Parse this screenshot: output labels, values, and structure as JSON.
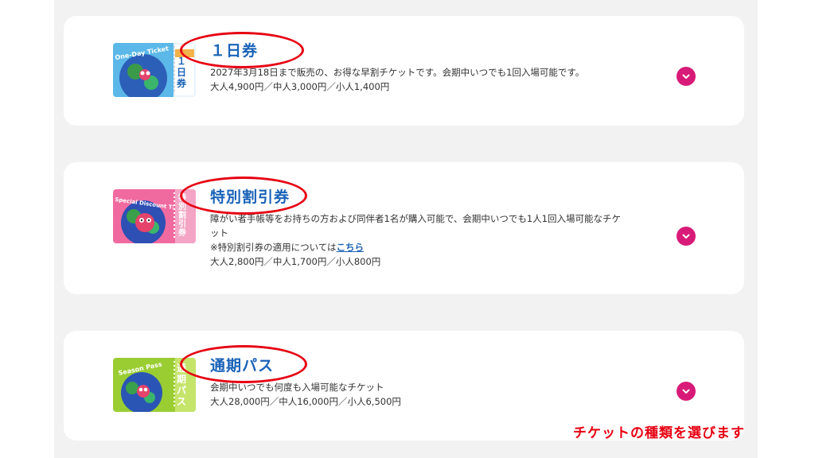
{
  "tickets": [
    {
      "title": "１日券",
      "image_label": "One-Day Ticket",
      "image_side": "１日券",
      "description": "2027年3月18日まで販売の、お得な早割チケットです。会期中いつでも1回入場可能です。",
      "prices": "大人4,900円／中人3,000円／小人1,400円"
    },
    {
      "title": "特別割引券",
      "image_label": "Special Discount Ticket",
      "image_side": "特別割引券",
      "description_line1": "障がい者手帳等をお持ちの方および同伴者1名が購入可能で、会期中いつでも1人1回入場可能なチケ",
      "description_line2": "ット",
      "note_prefix": "※特別割引券の適用については",
      "note_link": "こちら",
      "prices": "大人2,800円／中人1,700円／小人800円"
    },
    {
      "title": "通期パス",
      "image_label": "Season Pass",
      "image_side": "通期パス",
      "description": "会期中いつでも何度も入場可能なチケット",
      "prices": "大人28,000円／中人16,000円／小人6,500円"
    }
  ],
  "caption": "チケットの種類を選びます",
  "colors": {
    "title_blue": "#1a63b8",
    "toggle_magenta": "#d81b78",
    "annotation_red": "#e60012",
    "panel_gray": "#f2f2f2"
  },
  "icons": {
    "toggle": "chevron-down-icon"
  }
}
